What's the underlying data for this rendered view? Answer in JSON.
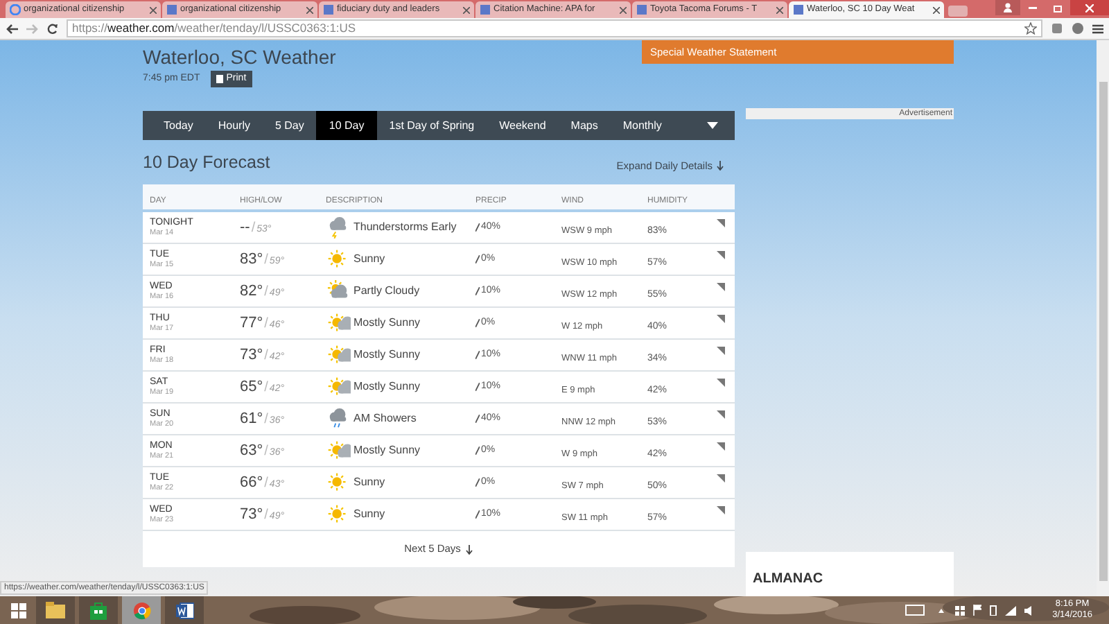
{
  "browser": {
    "tabs": [
      {
        "title": "organizational citizenship",
        "selected": false
      },
      {
        "title": "organizational citizenship",
        "selected": false
      },
      {
        "title": "fiduciary duty and leaders",
        "selected": false
      },
      {
        "title": "Citation Machine: APA for",
        "selected": false
      },
      {
        "title": "Toyota Tacoma Forums - T",
        "selected": false
      },
      {
        "title": "Waterloo, SC 10 Day Weat",
        "selected": true
      }
    ],
    "url": {
      "scheme": "https://",
      "host": "weather.com",
      "path": "/weather/tenday/l/USSC0363:1:US"
    },
    "status_url": "https://weather.com/weather/tenday/l/USSC0363:1:US"
  },
  "page": {
    "title": "Waterloo, SC Weather",
    "time": "7:45 pm EDT",
    "print_button": "Print",
    "alert": "Special Weather Statement",
    "advertisement": "Advertisement",
    "nav": [
      {
        "label": "Today",
        "selected": false
      },
      {
        "label": "Hourly",
        "selected": false
      },
      {
        "label": "5 Day",
        "selected": false
      },
      {
        "label": "10 Day",
        "selected": true
      },
      {
        "label": "1st Day of Spring",
        "selected": false
      },
      {
        "label": "Weekend",
        "selected": false
      },
      {
        "label": "Maps",
        "selected": false
      },
      {
        "label": "Monthly",
        "selected": false
      }
    ],
    "forecast": {
      "title": "10 Day Forecast",
      "expand": "Expand Daily Details",
      "columns": [
        "DAY",
        "HIGH/LOW",
        "DESCRIPTION",
        "PRECIP",
        "WIND",
        "HUMIDITY"
      ],
      "separator": "/",
      "rows": [
        {
          "day": "TONIGHT",
          "date": "Mar 14",
          "high": "--",
          "low": "53°",
          "kind": "thunderstorm",
          "description": "Thunderstorms Early",
          "precip": "40%",
          "wind": "WSW 9 mph",
          "humidity": "83%"
        },
        {
          "day": "TUE",
          "date": "Mar 15",
          "high": "83°",
          "low": "59°",
          "kind": "sunny",
          "description": "Sunny",
          "precip": "0%",
          "wind": "WSW 10 mph",
          "humidity": "57%"
        },
        {
          "day": "WED",
          "date": "Mar 16",
          "high": "82°",
          "low": "49°",
          "kind": "partly-cloudy",
          "description": "Partly Cloudy",
          "precip": "10%",
          "wind": "WSW 12 mph",
          "humidity": "55%"
        },
        {
          "day": "THU",
          "date": "Mar 17",
          "high": "77°",
          "low": "46°",
          "kind": "mostly-sunny",
          "description": "Mostly Sunny",
          "precip": "0%",
          "wind": "W 12 mph",
          "humidity": "40%"
        },
        {
          "day": "FRI",
          "date": "Mar 18",
          "high": "73°",
          "low": "42°",
          "kind": "mostly-sunny",
          "description": "Mostly Sunny",
          "precip": "10%",
          "wind": "WNW 11 mph",
          "humidity": "34%"
        },
        {
          "day": "SAT",
          "date": "Mar 19",
          "high": "65°",
          "low": "42°",
          "kind": "mostly-sunny",
          "description": "Mostly Sunny",
          "precip": "10%",
          "wind": "E 9 mph",
          "humidity": "42%"
        },
        {
          "day": "SUN",
          "date": "Mar 20",
          "high": "61°",
          "low": "36°",
          "kind": "showers",
          "description": "AM Showers",
          "precip": "40%",
          "wind": "NNW 12 mph",
          "humidity": "53%"
        },
        {
          "day": "MON",
          "date": "Mar 21",
          "high": "63°",
          "low": "36°",
          "kind": "mostly-sunny",
          "description": "Mostly Sunny",
          "precip": "0%",
          "wind": "W 9 mph",
          "humidity": "42%"
        },
        {
          "day": "TUE",
          "date": "Mar 22",
          "high": "66°",
          "low": "43°",
          "kind": "sunny",
          "description": "Sunny",
          "precip": "0%",
          "wind": "SW 7 mph",
          "humidity": "50%"
        },
        {
          "day": "WED",
          "date": "Mar 23",
          "high": "73°",
          "low": "49°",
          "kind": "sunny",
          "description": "Sunny",
          "precip": "10%",
          "wind": "SW 11 mph",
          "humidity": "57%"
        }
      ],
      "more": "Next 5 Days"
    },
    "almanac": {
      "title": "ALMANAC"
    }
  },
  "taskbar": {
    "apps": [
      {
        "kind": "explorer",
        "selected": false
      },
      {
        "kind": "store",
        "selected": false
      },
      {
        "kind": "chrome",
        "selected": true
      },
      {
        "kind": "word",
        "selected": false
      }
    ],
    "time": "8:16 PM",
    "date": "3/14/2016"
  }
}
